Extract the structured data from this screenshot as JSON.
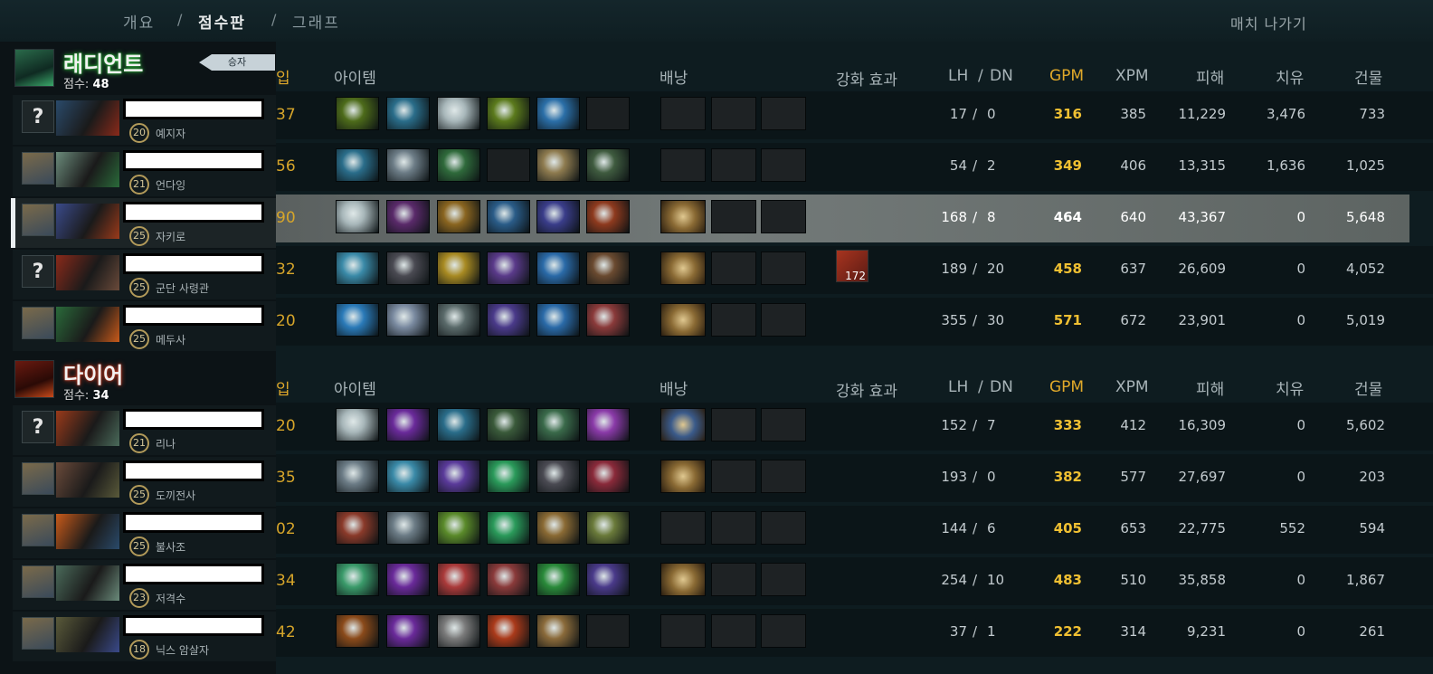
{
  "nav": {
    "overview": "개요",
    "scoreboard": "점수판",
    "graphs": "그래프",
    "sep": "/",
    "exit": "매치 나가기"
  },
  "headers": {
    "items": "아이템",
    "backpack": "배낭",
    "buffs": "강화 효과",
    "lh": "LH",
    "slash": "/",
    "dn": "DN",
    "gpm": "GPM",
    "xpm": "XPM",
    "damage": "피해",
    "heal": "치유",
    "building": "건물",
    "cutoff": "입"
  },
  "colors": {
    "radiant_glow": "#2fbf3c",
    "dire_glow": "#d03a1f",
    "gpm": "#f0c032"
  },
  "radiant": {
    "name": "래디언트",
    "score_label": "점수:",
    "score": "48",
    "winner": "승자",
    "players": [
      {
        "avatar": "?",
        "level": "20",
        "hero": "예지자",
        "cut": "37",
        "lh": "17",
        "dn": "0",
        "gpm": "316",
        "xpm": "385",
        "damage": "11,229",
        "heal": "3,476",
        "building": "733",
        "items": [
          "#4d6b1a",
          "#2a6d8a",
          "#a8b7ba",
          "#5b7a1c",
          "#2b6fa8",
          "empty"
        ],
        "backpack": [
          "empty",
          "empty",
          "empty"
        ]
      },
      {
        "avatar": "",
        "level": "21",
        "hero": "언다잉",
        "cut": "56",
        "lh": "54",
        "dn": "2",
        "gpm": "349",
        "xpm": "406",
        "damage": "13,315",
        "heal": "1,636",
        "building": "1,025",
        "items": [
          "#2a6d8a",
          "#6c7c86",
          "#2f6a3b",
          "empty",
          "#8e7b4f",
          "#3f5b3f"
        ],
        "backpack": [
          "empty",
          "empty",
          "empty"
        ]
      },
      {
        "avatar": "",
        "level": "25",
        "hero": "자키로",
        "cut": "90",
        "lh": "168",
        "dn": "8",
        "gpm": "464",
        "xpm": "640",
        "damage": "43,367",
        "heal": "0",
        "building": "5,648",
        "items": [
          "#a8b7ba",
          "#5a2a6a",
          "#8a6520",
          "#2a5c88",
          "#3a3d8a",
          "#8e3a1e"
        ],
        "backpack": [
          "#8a6a34",
          "empty",
          "empty"
        ],
        "selected": true
      },
      {
        "avatar": "?",
        "level": "25",
        "hero": "군단 사령관",
        "cut": "32",
        "lh": "189",
        "dn": "20",
        "gpm": "458",
        "xpm": "637",
        "damage": "26,609",
        "heal": "0",
        "building": "4,052",
        "items": [
          "#3a8aa8",
          "#4a4a52",
          "#a88a22",
          "#5a3a8a",
          "#2a6aa8",
          "#6a4a30"
        ],
        "backpack": [
          "#8a6a34",
          "empty",
          "empty"
        ],
        "buff": "172"
      },
      {
        "avatar": "",
        "level": "25",
        "hero": "메두사",
        "cut": "20",
        "lh": "355",
        "dn": "30",
        "gpm": "571",
        "xpm": "672",
        "damage": "23,901",
        "heal": "0",
        "building": "5,019",
        "items": [
          "#2a7ab8",
          "#7a8aa0",
          "#5a6a6a",
          "#4a3a8a",
          "#2a6aa8",
          "#8a3a3a"
        ],
        "backpack": [
          "#8a6a34",
          "empty",
          "empty"
        ]
      }
    ]
  },
  "dire": {
    "name": "다이어",
    "score_label": "점수:",
    "score": "34",
    "players": [
      {
        "avatar": "?",
        "level": "21",
        "hero": "리나",
        "cut": "20",
        "lh": "152",
        "dn": "7",
        "gpm": "333",
        "xpm": "412",
        "damage": "16,309",
        "heal": "0",
        "building": "5,602",
        "items": [
          "#a8b7ba",
          "#6a2a9a",
          "#2a6d8a",
          "#3a5a3a",
          "#3a6a4a",
          "#8a3aa8"
        ],
        "backpack": [
          "#3a5a8a",
          "empty",
          "empty"
        ]
      },
      {
        "avatar": "",
        "level": "25",
        "hero": "도끼전사",
        "cut": "35",
        "lh": "193",
        "dn": "0",
        "gpm": "382",
        "xpm": "577",
        "damage": "27,697",
        "heal": "0",
        "building": "203",
        "items": [
          "#6c7c86",
          "#3a8aa8",
          "#5a3a9a",
          "#2a9a5a",
          "#4a4a52",
          "#8a2a3a"
        ],
        "backpack": [
          "#8a6a34",
          "empty",
          "empty"
        ]
      },
      {
        "avatar": "",
        "level": "25",
        "hero": "불사조",
        "cut": "02",
        "lh": "144",
        "dn": "6",
        "gpm": "405",
        "xpm": "653",
        "damage": "22,775",
        "heal": "552",
        "building": "594",
        "items": [
          "#8a3a2a",
          "#6c7c86",
          "#5a8a2a",
          "#2a9a5a",
          "#8a6a34",
          "#6a7a3a"
        ],
        "backpack": [
          "empty",
          "empty",
          "empty"
        ]
      },
      {
        "avatar": "",
        "level": "23",
        "hero": "저격수",
        "cut": "34",
        "lh": "254",
        "dn": "10",
        "gpm": "483",
        "xpm": "510",
        "damage": "35,858",
        "heal": "0",
        "building": "1,867",
        "items": [
          "#3a9a6a",
          "#6a2a9a",
          "#aa3a3a",
          "#8a3a3a",
          "#2a8a3a",
          "#4a3a8a"
        ],
        "backpack": [
          "#8a6a34",
          "empty",
          "empty"
        ]
      },
      {
        "avatar": "",
        "level": "18",
        "hero": "닉스 암살자",
        "cut": "42",
        "lh": "37",
        "dn": "1",
        "gpm": "222",
        "xpm": "314",
        "damage": "9,231",
        "heal": "0",
        "building": "261",
        "items": [
          "#8a4a1a",
          "#6a2a9a",
          "#7a7a7a",
          "#aa3a1a",
          "#8a6a3a",
          "empty"
        ],
        "backpack": [
          "empty",
          "empty",
          "empty"
        ]
      }
    ]
  }
}
